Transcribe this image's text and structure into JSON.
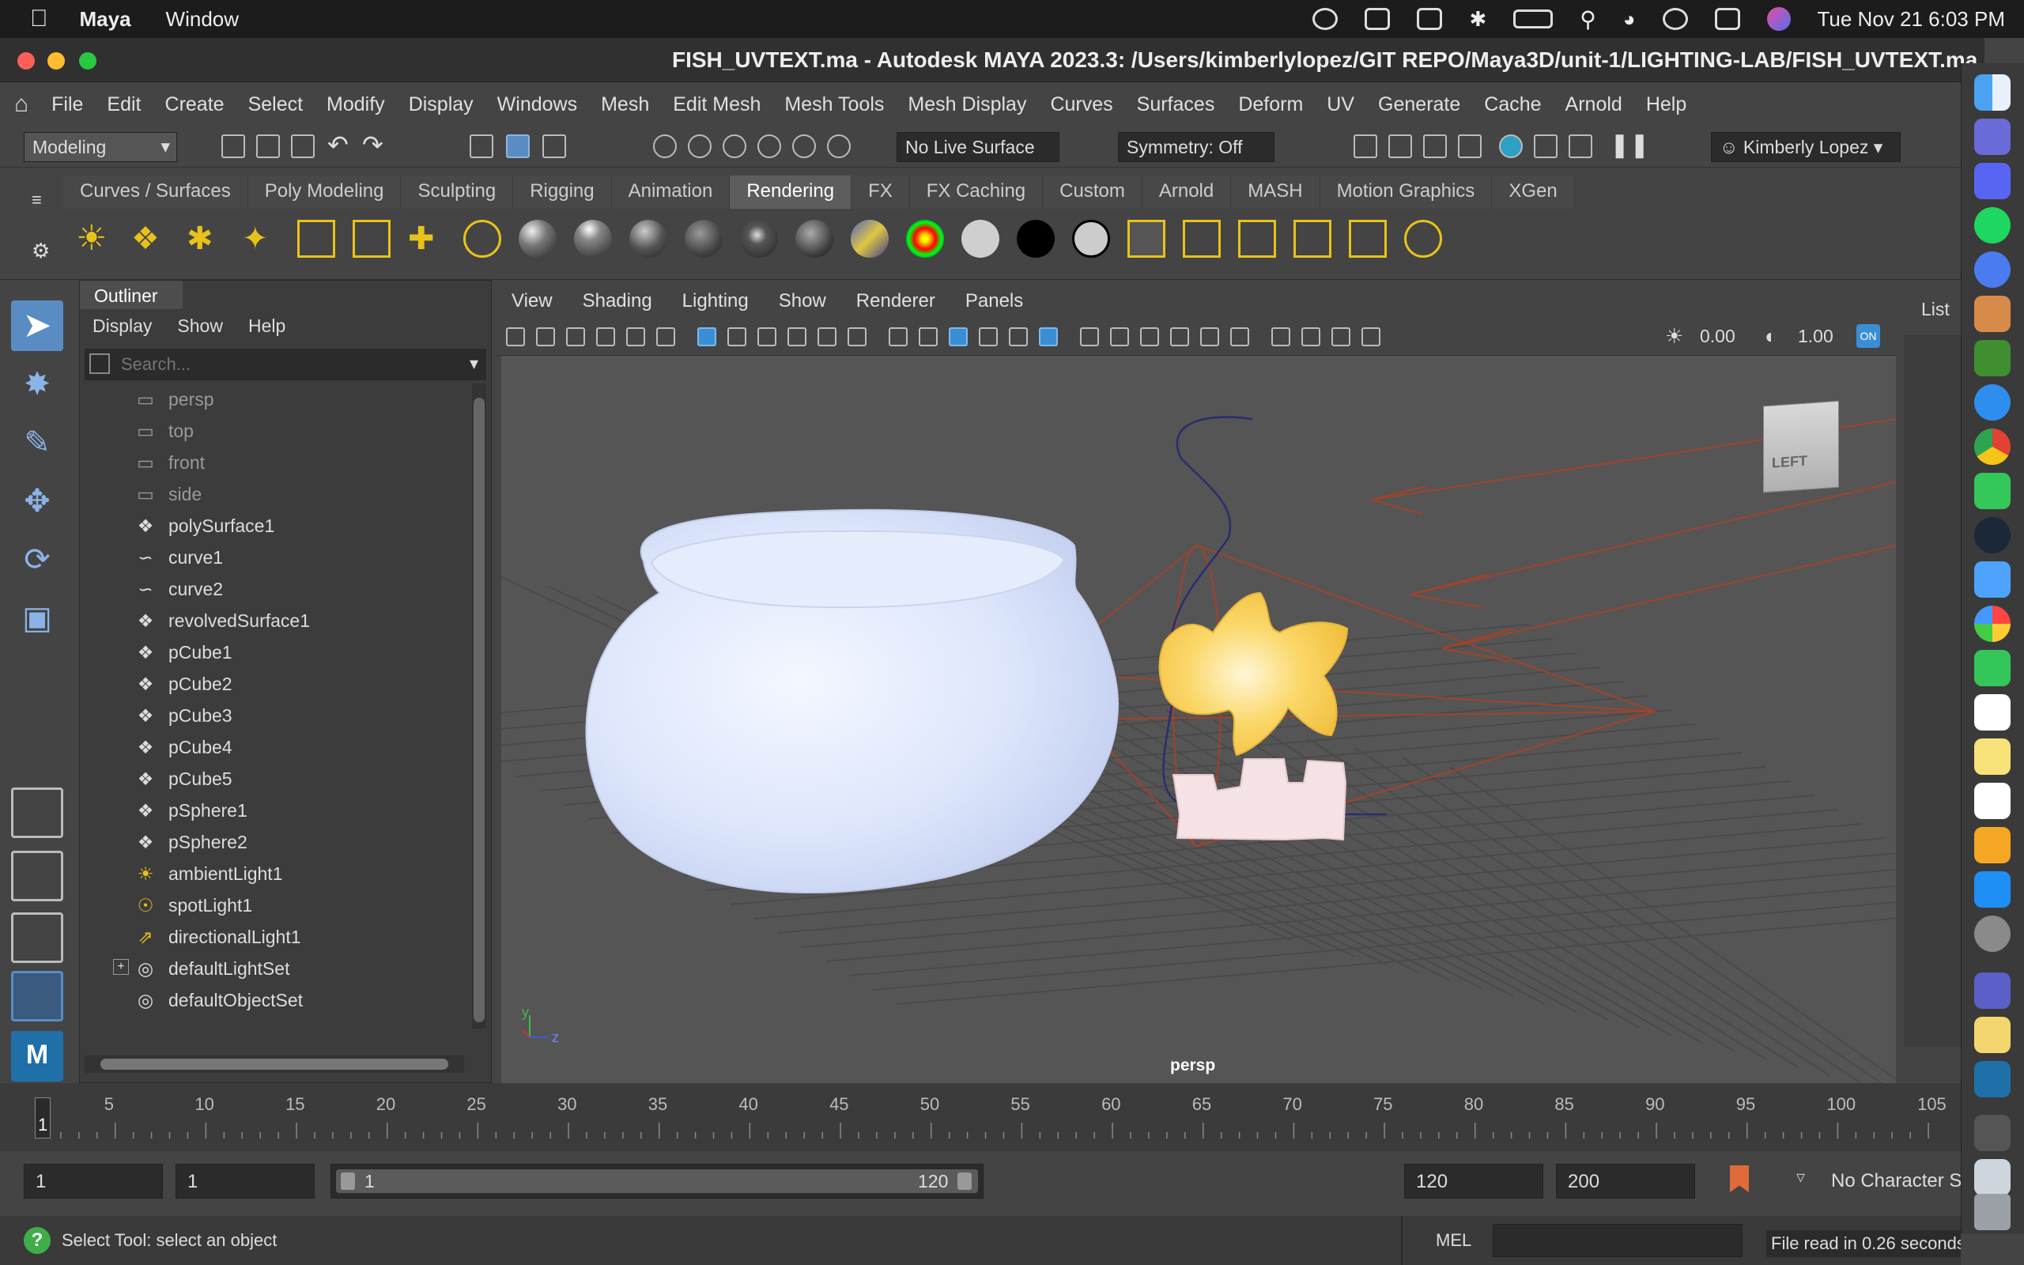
{
  "menubar": {
    "app_name": "Maya",
    "window_menu": "Window",
    "datetime": "Tue Nov 21  6:03 PM"
  },
  "window": {
    "title": "FISH_UVTEXT.ma - Autodesk MAYA 2023.3: /Users/kimberlylopez/GIT REPO/Maya3D/unit-1/LIGHTING-LAB/FISH_UVTEXT.ma"
  },
  "main_menu": [
    "File",
    "Edit",
    "Create",
    "Select",
    "Modify",
    "Display",
    "Windows",
    "Mesh",
    "Edit Mesh",
    "Mesh Tools",
    "Mesh Display",
    "Curves",
    "Surfaces",
    "Deform",
    "UV",
    "Generate",
    "Cache",
    "Arnold",
    "Help"
  ],
  "status_line": {
    "menu_set": "Modeling",
    "live_surface": "No Live Surface",
    "symmetry": "Symmetry: Off",
    "user": "Kimberly Lopez"
  },
  "shelf_tabs": [
    "Curves / Surfaces",
    "Poly Modeling",
    "Sculpting",
    "Rigging",
    "Animation",
    "Rendering",
    "FX",
    "FX Caching",
    "Custom",
    "Arnold",
    "MASH",
    "Motion Graphics",
    "XGen"
  ],
  "active_shelf": "Rendering",
  "outliner": {
    "title": "Outliner",
    "menu": [
      "Display",
      "Show",
      "Help"
    ],
    "search_placeholder": "Search...",
    "items": [
      {
        "label": "persp",
        "icon": "camera-icon",
        "dim": true
      },
      {
        "label": "top",
        "icon": "camera-icon",
        "dim": true
      },
      {
        "label": "front",
        "icon": "camera-icon",
        "dim": true
      },
      {
        "label": "side",
        "icon": "camera-icon",
        "dim": true
      },
      {
        "label": "polySurface1",
        "icon": "mesh-icon"
      },
      {
        "label": "curve1",
        "icon": "curve-icon"
      },
      {
        "label": "curve2",
        "icon": "curve-icon"
      },
      {
        "label": "revolvedSurface1",
        "icon": "mesh-icon"
      },
      {
        "label": "pCube1",
        "icon": "mesh-icon"
      },
      {
        "label": "pCube2",
        "icon": "mesh-icon"
      },
      {
        "label": "pCube3",
        "icon": "mesh-icon"
      },
      {
        "label": "pCube4",
        "icon": "mesh-icon"
      },
      {
        "label": "pCube5",
        "icon": "mesh-icon"
      },
      {
        "label": "pSphere1",
        "icon": "mesh-icon"
      },
      {
        "label": "pSphere2",
        "icon": "mesh-icon"
      },
      {
        "label": "ambientLight1",
        "icon": "ambient-light-icon"
      },
      {
        "label": "spotLight1",
        "icon": "spot-light-icon"
      },
      {
        "label": "directionalLight1",
        "icon": "directional-light-icon"
      },
      {
        "label": "defaultLightSet",
        "icon": "set-icon",
        "expand": true
      },
      {
        "label": "defaultObjectSet",
        "icon": "set-icon"
      }
    ]
  },
  "viewport": {
    "menu": [
      "View",
      "Shading",
      "Lighting",
      "Show",
      "Renderer",
      "Panels"
    ],
    "exposure": "0.00",
    "gamma": "1.00",
    "camera_label": "persp",
    "viewcube_label": "LEFT",
    "right_panel_label": "List"
  },
  "timeline": {
    "ticks": [
      "5",
      "10",
      "15",
      "20",
      "25",
      "30",
      "35",
      "40",
      "45",
      "50",
      "55",
      "60",
      "65",
      "70",
      "75",
      "80",
      "85",
      "90",
      "95",
      "100",
      "105"
    ],
    "current_frame": "1"
  },
  "range": {
    "start": "1",
    "playback_start": "1",
    "slider_start": "1",
    "slider_end": "120",
    "playback_end": "120",
    "end": "200",
    "character_set": "No Character Set"
  },
  "help_line": {
    "message": "Select Tool: select an object",
    "mel_label": "MEL",
    "result": "File read in  0.26 seconds."
  }
}
